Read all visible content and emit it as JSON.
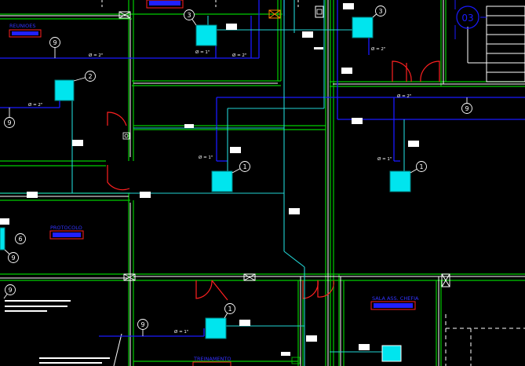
{
  "drawing": {
    "room_labels": [
      "REUNIOES",
      "PROTOCOLO",
      "SALA ASS. CHEFIA",
      "TREINAMENTO"
    ],
    "pipe_label": "Ø = 2\"",
    "pipe_label_1in": "Ø = 1\"",
    "callouts": [
      "1",
      "2",
      "3",
      "6",
      "9"
    ],
    "grid_bubble": "03"
  },
  "colors": {
    "background": "#000000",
    "wall_green": "#00cc00",
    "wall_white": "#ffffff",
    "pipe_blue": "#1a1aff",
    "duct_cyan": "#22d3d3",
    "unit_fill": "#00e5ee",
    "door_red": "#ff2020",
    "label_blue": "#3333ff"
  }
}
